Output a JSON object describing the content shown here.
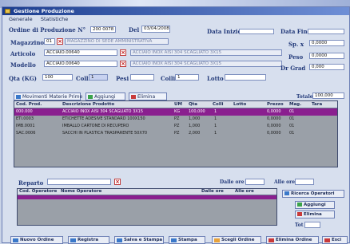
{
  "window": {
    "title": "Gestione Produzione"
  },
  "menu": [
    "Generale",
    "Statistiche"
  ],
  "header": {
    "title": "Ordine di Produzione N°",
    "order_no": "200 0078",
    "del_label": "Del",
    "del_value": "03/04/2008",
    "data_inizio_label": "Data Inizio",
    "data_fine_label": "Data Fine"
  },
  "fields": {
    "magazzino_label": "Magazzino",
    "magazzino_code": "01",
    "magazzino_desc": "MAGAZZINO DI SEDE AMMINISTRATIVA",
    "articolo_label": "Articolo",
    "articolo_code": "ACCIAIO.00640",
    "articolo_desc": "ACCIAIO INOX AISI 304 SCAGLIATO 3X15",
    "modello_label": "Modello",
    "modello_code": "ACCIAIO.00640",
    "modello_desc": "ACCIAIO INOX AISI 304 SCAGLIATO 3X15",
    "qta_label": "Qta (KG)",
    "qta_value": "100",
    "colli_label": "Colli",
    "colli_value": "1",
    "pesi_label": "Pesi",
    "colli2_label": "Colli",
    "colli2_value": "1",
    "lotto_label": "Lotto"
  },
  "right_fields": {
    "sp_label": "Sp. x",
    "sp_value": "0,0000",
    "peso_label": "Peso",
    "peso_value": "0,0000",
    "dr_label": "Dr Grad",
    "dr_value": "0,000"
  },
  "tabs": {
    "movimenti": "Movimenti Materie Prime",
    "aggiungi": "Aggiungi",
    "elimina": "Elimina",
    "totale_label": "Totale",
    "totale_value": "100,000"
  },
  "grid": {
    "headers": [
      "Cod. Prod.",
      "Descrizione Prodotto",
      "UM",
      "Qta",
      "Colli",
      "Lotto",
      "Prezzo",
      "Mag.",
      "Tara"
    ],
    "rows": [
      {
        "cod": "000.000",
        "desc": "ACCIAIO INOX AISI 304 SCAGLIATO 3X15",
        "um": "KG",
        "qta": "100,000",
        "colli": "1",
        "lotto": "",
        "prezzo": "0,0000",
        "mag": "01",
        "tara": ""
      },
      {
        "cod": "ETI.0003",
        "desc": "ETICHETTE ADESIVE STANDARD 100X150",
        "um": "PZ",
        "qta": "1,000",
        "colli": "1",
        "lotto": "",
        "prezzo": "0,0000",
        "mag": "01",
        "tara": ""
      },
      {
        "cod": "IMB.0001",
        "desc": "IMBALLO CARTONE DI RECUPERO",
        "um": "PZ",
        "qta": "1,000",
        "colli": "1",
        "lotto": "",
        "prezzo": "0,0000",
        "mag": "01",
        "tara": ""
      },
      {
        "cod": "SAC.0006",
        "desc": "SACCHI IN PLASTICA TRASPARENTE 50X70",
        "um": "PZ",
        "qta": "2,000",
        "colli": "1",
        "lotto": "",
        "prezzo": "0,0000",
        "mag": "01",
        "tara": ""
      }
    ]
  },
  "reparto": {
    "label": "Reparto",
    "dalle_label": "Dalle ore",
    "alle_label": "Alle ore"
  },
  "operators": {
    "headers": [
      "Cod. Operatore",
      "Nome Operatore",
      "Dalle ore",
      "Alle ore"
    ],
    "buttons": {
      "ricerca": "Ricerca Operatori",
      "aggiungi": "Aggiungi",
      "elimina": "Elimina"
    },
    "tot_label": "Tot"
  },
  "bottom": [
    "Nuovo Ordine",
    "Registra",
    "Salva e Stampa",
    "Stampa",
    "Scegli Ordine",
    "Elimina Ordine",
    "Esci"
  ],
  "colors": {
    "title": "#1b3d8f",
    "selected_row": "#8a1f8f",
    "grid_bg": "#9aa0a8",
    "window_bg": "#d7dfee"
  }
}
